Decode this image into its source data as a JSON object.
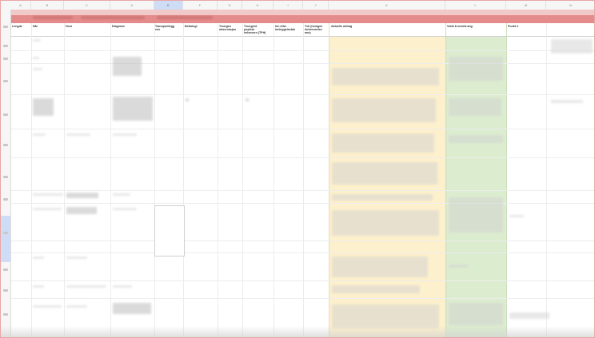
{
  "column_letters": [
    "A",
    "B",
    "C",
    "D",
    "E",
    "F",
    "G",
    "H",
    "I",
    "J",
    "K",
    "L",
    "M",
    "N"
  ],
  "selected_column": "E",
  "headers": {
    "a": "Lengde",
    "b": "Når",
    "c": "Hvor",
    "d": "Diagnose",
    "e": "Transportlegg\nene",
    "f": "Befaringi",
    "g": "Tvungen\nobservasjon",
    "h": "Tvungent\npsykisk\nhelsevern (TPH)",
    "i": "Inn etter\ninnleggelsetak",
    "j": "Tvil (tvungen\ninnlemmelse\nmm)",
    "k": "Aktuelle utdrag",
    "l": "Veldt & med/w ang",
    "m": "Punkt 4"
  },
  "colors": {
    "banner": "#e48b8b",
    "banner_light": "#f1c9c9",
    "quote_column": "#fdf0cc",
    "assessment_column": "#dceccf",
    "selection": "#cfdcf5"
  }
}
